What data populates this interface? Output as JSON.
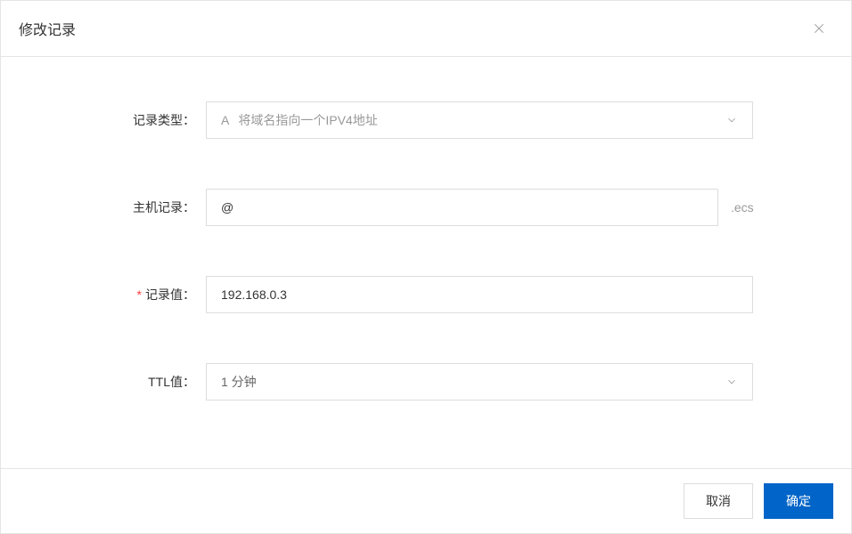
{
  "modal": {
    "title": "修改记录"
  },
  "form": {
    "recordType": {
      "label": "记录类型：",
      "prefix": "A",
      "value": "将域名指向一个IPV4地址"
    },
    "hostRecord": {
      "label": "主机记录：",
      "value": "@",
      "suffix": ".ecs"
    },
    "recordValue": {
      "label": "记录值：",
      "value": "192.168.0.3"
    },
    "ttl": {
      "label": "TTL值：",
      "value": "1 分钟"
    }
  },
  "footer": {
    "cancel": "取消",
    "confirm": "确定"
  }
}
